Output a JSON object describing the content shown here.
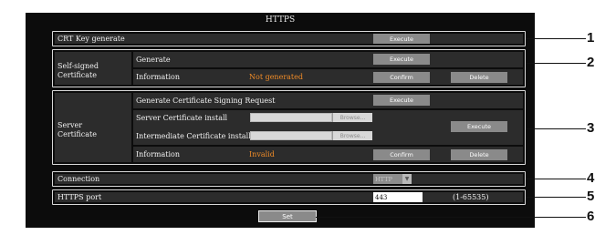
{
  "page_title": "HTTPS",
  "crt_key": {
    "label": "CRT Key generate",
    "execute": "Execute"
  },
  "self_signed": {
    "label": "Self-signed Certificate",
    "generate_label": "Generate",
    "generate_button": "Execute",
    "information_label": "Information",
    "information_status": "Not generated",
    "confirm_button": "Confirm",
    "delete_button": "Delete"
  },
  "server_cert": {
    "label": "Server Certificate",
    "csr_label": "Generate Certificate Signing Request",
    "csr_button": "Execute",
    "install_label": "Server Certificate install",
    "intermediate_label": "Intermediate Certificate install",
    "browse_button": "Browse...",
    "install_execute": "Execute",
    "information_label": "Information",
    "information_status": "Invalid",
    "confirm_button": "Confirm",
    "delete_button": "Delete"
  },
  "connection": {
    "label": "Connection",
    "selected": "HTTP"
  },
  "https_port": {
    "label": "HTTPS port",
    "value": "443",
    "range": "(1-65535)"
  },
  "set_button": "Set",
  "callouts": [
    "1",
    "2",
    "3",
    "4",
    "5",
    "6"
  ],
  "colors": {
    "orange_status": "#f08c28",
    "panel_bg": "#0c0c0c",
    "cell_bg": "#2c2c2c",
    "button_gray": "#8a8a8a"
  }
}
